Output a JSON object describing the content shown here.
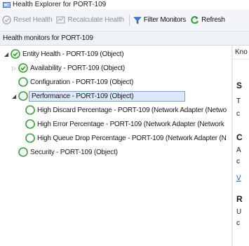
{
  "window": {
    "title": "Health Explorer for PORT-109"
  },
  "toolbar": {
    "reset_health": "Reset Health",
    "recalculate_health": "Recalculate Health",
    "filter_monitors": "Filter Monitors",
    "refresh": "Refresh"
  },
  "panel": {
    "header": "Health monitors for PORT-109"
  },
  "tree": {
    "nodes": [
      {
        "label": "Entity Health - PORT-109 (Object)",
        "state": "healthy",
        "expander": "expanded"
      },
      {
        "label": "Availability - PORT-109 (Object)",
        "state": "healthy",
        "expander": "collapsed"
      },
      {
        "label": "Configuration - PORT-109 (Object)",
        "state": "not-monitored",
        "expander": "none"
      },
      {
        "label": "Performance - PORT-109 (Object)",
        "state": "not-monitored",
        "expander": "expanded",
        "selected": true
      },
      {
        "label": "High Discard Percentage - PORT-109 (Network Adapter (Netwo",
        "state": "not-monitored",
        "expander": "none"
      },
      {
        "label": "High Error Percentage - PORT-109 (Network Adapter (Network",
        "state": "not-monitored",
        "expander": "none"
      },
      {
        "label": "High Queue Drop Percentage - PORT-109 (Network Adapter (N",
        "state": "not-monitored",
        "expander": "none"
      },
      {
        "label": "Security - PORT-109 (Object)",
        "state": "not-monitored",
        "expander": "none"
      }
    ]
  },
  "right_pane": {
    "header": "Kno",
    "fragments": [
      "S",
      "T",
      "c",
      "C",
      "A",
      "c",
      "V",
      "R",
      "U",
      "c"
    ]
  },
  "colors": {
    "healthy_green": "#2fa52a",
    "not_monitored_green": "#3aa03a",
    "selection_fill": "#dce9f9",
    "selection_border": "#7da2ce",
    "link_blue": "#2a5db0"
  }
}
